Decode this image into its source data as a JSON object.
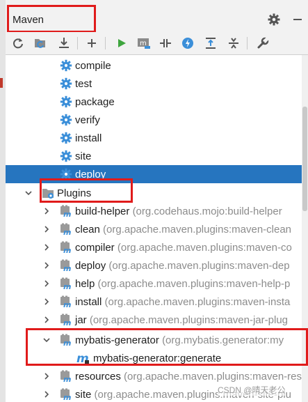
{
  "window": {
    "title": "Maven"
  },
  "toolbar": {
    "buttons": [
      "reload-icon",
      "add-projects-icon",
      "download-icon",
      "add-icon",
      "run-icon",
      "execute-goal-icon",
      "toggle-offline-icon",
      "skip-tests-icon",
      "show-diagram-icon",
      "collapse-icon",
      "settings-wrench-icon"
    ]
  },
  "lifecycle": [
    "compile",
    "test",
    "package",
    "verify",
    "install",
    "site",
    "deploy"
  ],
  "plugins_label": "Plugins",
  "plugins": [
    {
      "name": "build-helper",
      "group": "(org.codehaus.mojo:build-helper"
    },
    {
      "name": "clean",
      "group": "(org.apache.maven.plugins:maven-clean"
    },
    {
      "name": "compiler",
      "group": "(org.apache.maven.plugins:maven-co"
    },
    {
      "name": "deploy",
      "group": "(org.apache.maven.plugins:maven-dep"
    },
    {
      "name": "help",
      "group": "(org.apache.maven.plugins:maven-help-p"
    },
    {
      "name": "install",
      "group": "(org.apache.maven.plugins:maven-insta"
    },
    {
      "name": "jar",
      "group": "(org.apache.maven.plugins:maven-jar-plug"
    },
    {
      "name": "mybatis-generator",
      "group": "(org.mybatis.generator:my"
    },
    {
      "name": "resources",
      "group": "(org.apache.maven.plugins:maven-reso"
    },
    {
      "name": "site",
      "group": "(org.apache.maven.plugins:maven-site-plu"
    }
  ],
  "goal": "mybatis-generator:generate",
  "watermark": "CSDN @晴天老公",
  "colors": {
    "selection": "#2675bf",
    "gear": "#3b8fd9",
    "highlight_box": "#e01b1b"
  }
}
